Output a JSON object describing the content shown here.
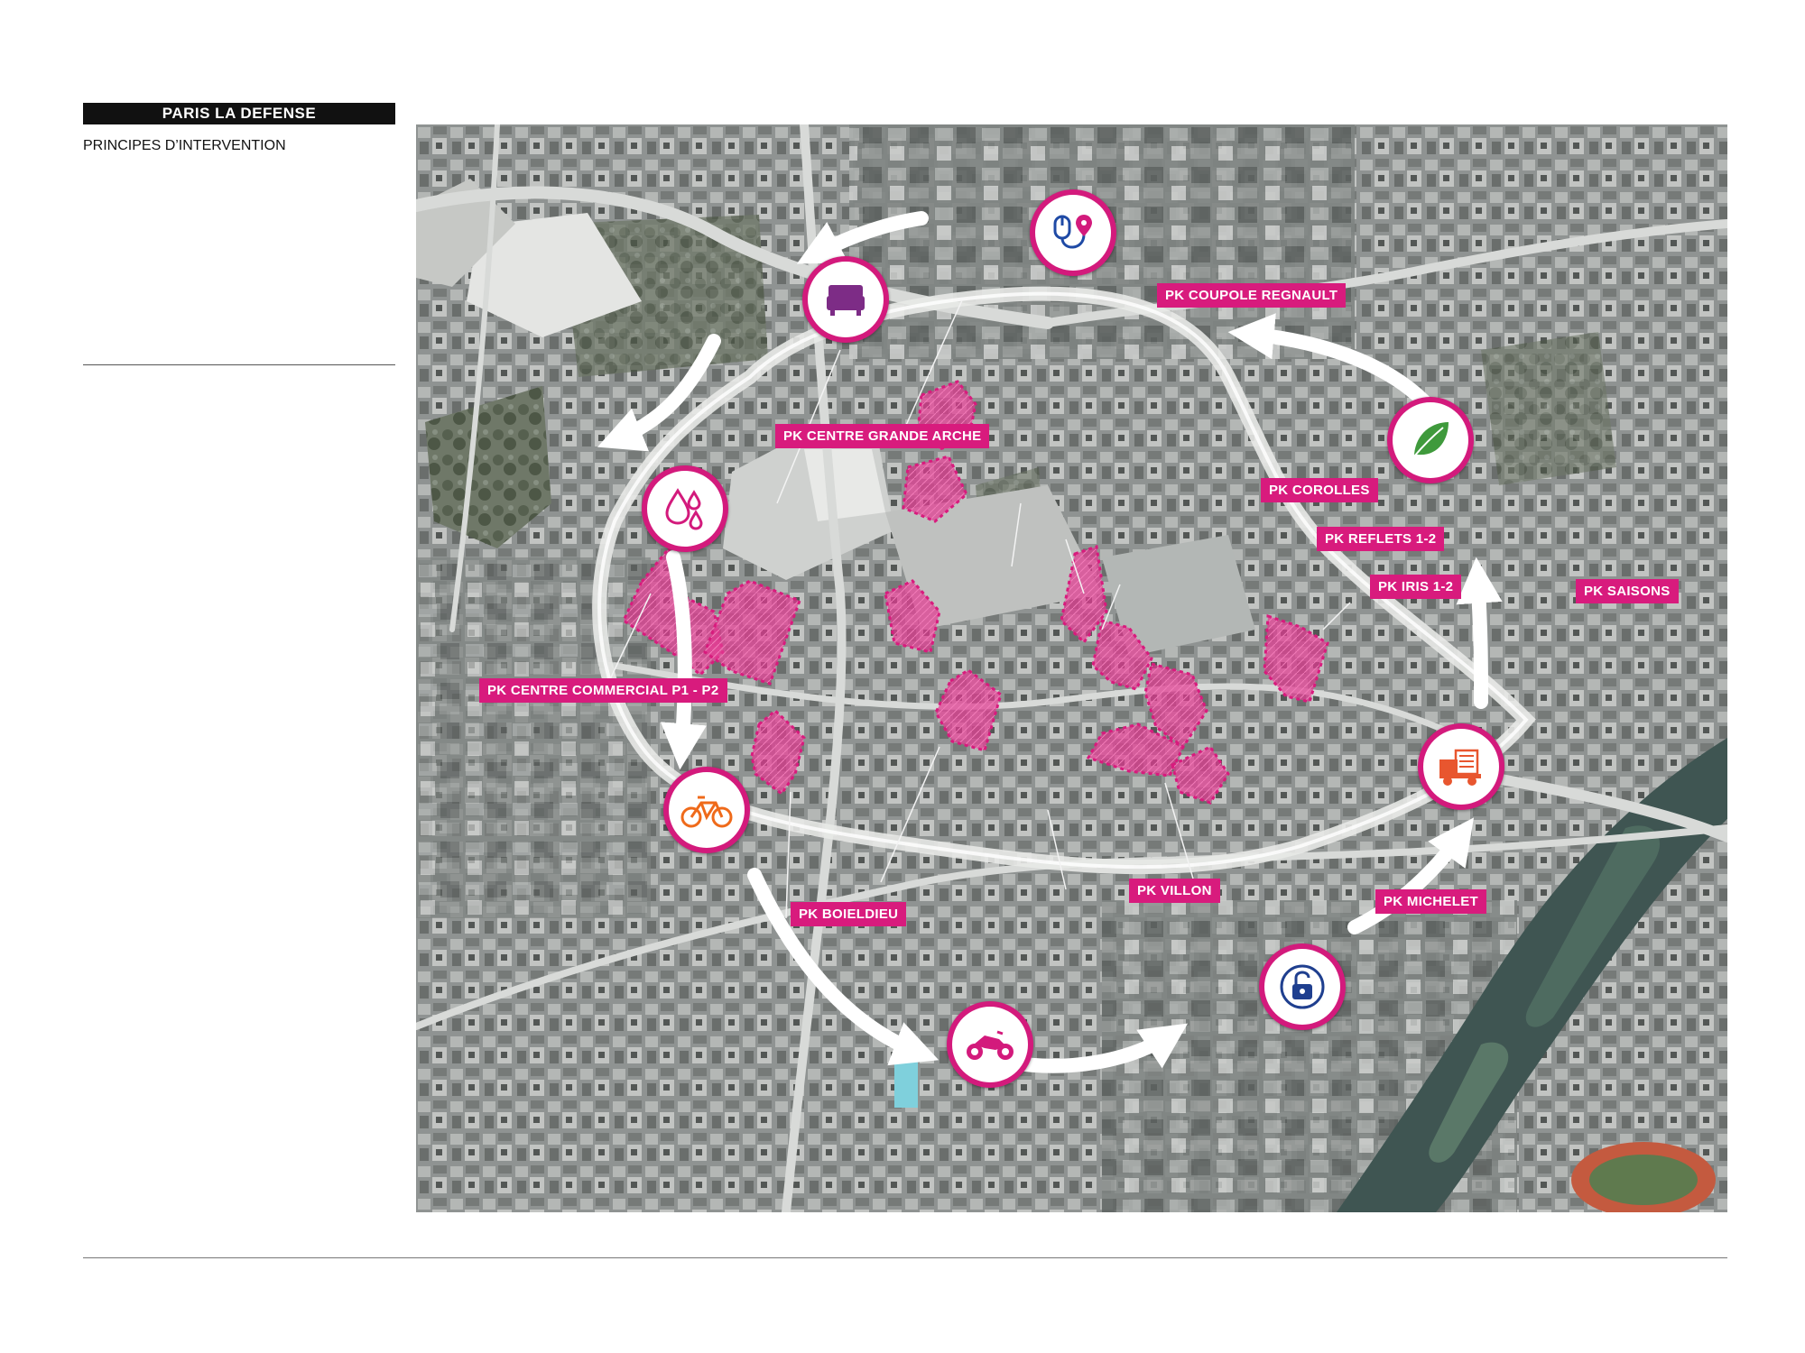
{
  "header": {
    "section_title": "PARIS LA DEFENSE",
    "subtitle": "PRINCIPES D’INTERVENTION"
  },
  "map": {
    "labels": {
      "coupole": "PK COUPOLE REGNAULT",
      "grande_arche": "PK CENTRE GRANDE ARCHE",
      "corolles": "PK COROLLES",
      "reflets": "PK REFLETS 1-2",
      "iris": "PK IRIS 1-2",
      "saisons": "PK SAISONS",
      "centre_commercial": "PK CENTRE COMMERCIAL P1 - P2",
      "villon": "PK VILLON",
      "michelet": "PK MICHELET",
      "boieldieu": "PK BOIELDIEU"
    },
    "icons": [
      "mouse-location-icon",
      "sofa-icon",
      "water-drops-icon",
      "bicycle-icon",
      "motorcycle-icon",
      "padlock-icon",
      "delivery-truck-icon",
      "leaf-icon"
    ],
    "colors": {
      "accent": "#d81b7d",
      "parking_fill": "#e23a92",
      "flow_arrow": "#ffffff"
    }
  }
}
